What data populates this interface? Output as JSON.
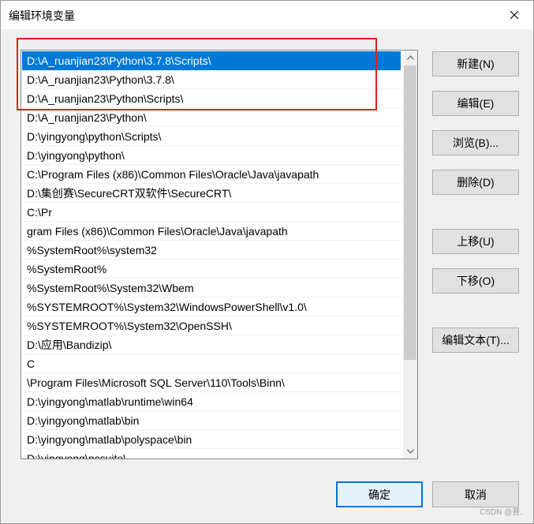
{
  "window": {
    "title": "编辑环境变量"
  },
  "list": {
    "items": [
      "D:\\A_ruanjian23\\Python\\3.7.8\\Scripts\\",
      "D:\\A_ruanjian23\\Python\\3.7.8\\",
      "D:\\A_ruanjian23\\Python\\Scripts\\",
      "D:\\A_ruanjian23\\Python\\",
      "D:\\yingyong\\python\\Scripts\\",
      "D:\\yingyong\\python\\",
      "C:\\Program Files (x86)\\Common Files\\Oracle\\Java\\javapath",
      "D:\\集创赛\\SecureCRT双软件\\SecureCRT\\",
      "C:\\Pr",
      "gram Files (x86)\\Common Files\\Oracle\\Java\\javapath",
      "%SystemRoot%\\system32",
      "%SystemRoot%",
      "%SystemRoot%\\System32\\Wbem",
      "%SYSTEMROOT%\\System32\\WindowsPowerShell\\v1.0\\",
      "%SYSTEMROOT%\\System32\\OpenSSH\\",
      "D:\\应用\\Bandizip\\",
      "C",
      "\\Program Files\\Microsoft SQL Server\\110\\Tools\\Binn\\",
      "D:\\yingyong\\matlab\\runtime\\win64",
      "D:\\yingyong\\matlab\\bin",
      "D:\\yingyong\\matlab\\polyspace\\bin",
      "D:\\yingyong\\pcsuite\\"
    ],
    "selected_index": 0
  },
  "buttons": {
    "new": "新建(N)",
    "edit": "编辑(E)",
    "browse": "浏览(B)...",
    "delete": "删除(D)",
    "move_up": "上移(U)",
    "move_down": "下移(O)",
    "edit_text": "编辑文本(T)...",
    "ok": "确定",
    "cancel": "取消"
  },
  "watermark": "CSDN @菩.",
  "colors": {
    "selection": "#0078d7",
    "annotation": "#e02020"
  },
  "icons": {
    "close": "close-icon",
    "scroll_up": "chevron-up-icon",
    "scroll_down": "chevron-down-icon"
  }
}
